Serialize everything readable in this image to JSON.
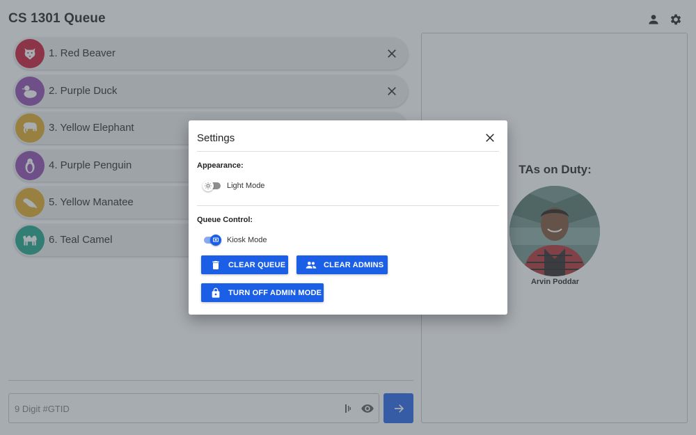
{
  "app": {
    "title": "CS 1301 Queue",
    "accent_color": "#1a5fe6",
    "top_icons": [
      "person-icon",
      "gear-icon"
    ]
  },
  "queue": {
    "items": [
      {
        "label": "1. Red Beaver",
        "animal_icon": "beaver-icon",
        "color": "#c8102e",
        "removable": true
      },
      {
        "label": "2. Purple Duck",
        "animal_icon": "duck-icon",
        "color": "#8e44ad",
        "removable": true
      },
      {
        "label": "3. Yellow Elephant",
        "animal_icon": "elephant-icon",
        "color": "#e1a81c",
        "removable": false
      },
      {
        "label": "4. Purple Penguin",
        "animal_icon": "penguin-icon",
        "color": "#8e44ad",
        "removable": false
      },
      {
        "label": "5. Yellow Manatee",
        "animal_icon": "manatee-icon",
        "color": "#e1a81c",
        "removable": false
      },
      {
        "label": "6. Teal Camel",
        "animal_icon": "camel-icon",
        "color": "#14a085",
        "removable": false
      }
    ]
  },
  "gtid_input": {
    "placeholder": "9 Digit #GTID",
    "value": ""
  },
  "tas": {
    "title": "TAs on Duty:",
    "members": [
      {
        "name": "Arvin Poddar"
      }
    ]
  },
  "settings_dialog": {
    "title": "Settings",
    "appearance_label": "Appearance:",
    "light_mode": {
      "label": "Light Mode",
      "on": false
    },
    "queue_control_label": "Queue Control:",
    "kiosk_mode": {
      "label": "Kiosk Mode",
      "on": true
    },
    "buttons": {
      "clear_queue": "CLEAR QUEUE",
      "clear_admins": "CLEAR ADMINS",
      "admin_mode": "TURN OFF ADMIN MODE"
    }
  }
}
